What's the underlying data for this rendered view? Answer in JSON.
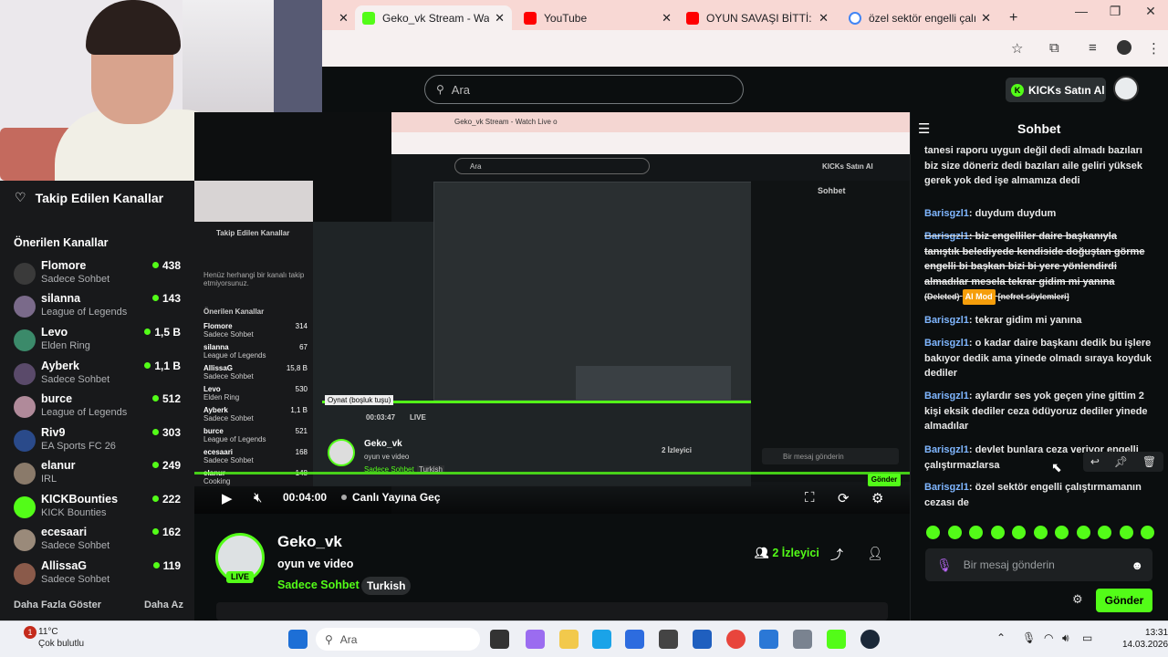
{
  "browser": {
    "tabs": [
      {
        "title": "Geko_vk Stream - Watch Live on KICK",
        "color": "#53fc18"
      },
      {
        "title": "YouTube",
        "color": "#ff0000"
      },
      {
        "title": "OYUN SAVAŞI BİTTİ: PLAYSTATION",
        "color": "#ff0000"
      },
      {
        "title": "özel sektör engelli çalıştırmamanın",
        "color": "#4285f4"
      }
    ],
    "new_tab": "+",
    "close": "✕"
  },
  "topnav": {
    "search_placeholder": "Ara",
    "buy_kicks": "KICKs Satın Al"
  },
  "sidebar": {
    "following_title": "Takip Edilen Kanallar",
    "recommended_title": "Önerilen Kanallar",
    "channels": [
      {
        "name": "Flomore",
        "category": "Sadece Sohbet",
        "viewers": "438",
        "avatar": "#3a3a3a"
      },
      {
        "name": "silanna",
        "category": "League of Legends",
        "viewers": "143",
        "avatar": "#7a6a8a"
      },
      {
        "name": "Levo",
        "category": "Elden Ring",
        "viewers": "1,5 B",
        "avatar": "#3b8a6a"
      },
      {
        "name": "Ayberk",
        "category": "Sadece Sohbet",
        "viewers": "1,1 B",
        "avatar": "#5a4a6a"
      },
      {
        "name": "burce",
        "category": "League of Legends",
        "viewers": "512",
        "avatar": "#b08a9a"
      },
      {
        "name": "Riv9",
        "category": "EA Sports FC 26",
        "viewers": "303",
        "avatar": "#2a4a8a"
      },
      {
        "name": "elanur",
        "category": "IRL",
        "viewers": "249",
        "avatar": "#8a7a6a"
      },
      {
        "name": "KICKBounties",
        "category": "KICK Bounties",
        "viewers": "222",
        "avatar": "#53fc18"
      },
      {
        "name": "ecesaari",
        "category": "Sadece Sohbet",
        "viewers": "162",
        "avatar": "#9a8a7a"
      },
      {
        "name": "AllissaG",
        "category": "Sadece Sohbet",
        "viewers": "119",
        "avatar": "#8a5a4a"
      }
    ],
    "show_more": "Daha Fazla Göster",
    "show_less": "Daha Az"
  },
  "player": {
    "time": "00:04:00",
    "go_live": "Canlı Yayına Geç"
  },
  "stream_embedded": {
    "tab_title": "Geko_vk Stream - Watch Live o",
    "search": "Ara",
    "buy_kicks": "KICKs Satın Al",
    "chat_title": "Sohbet",
    "following": "Takip Edilen Kanallar",
    "no_follow": "Henüz herhangi bir kanalı takip etmiyorsunuz.",
    "recommended": "Önerilen Kanallar",
    "tooltip": "Oynat (boşluk tuşu)",
    "time": "00:03:47",
    "live": "LIVE",
    "name": "Geko_vk",
    "title": "oyun ve video",
    "category": "Sadece Sohbet",
    "tag": "Turkish",
    "viewers": "2 İzleyici",
    "message_placeholder": "Bir mesaj gönderin",
    "send": "Gönder",
    "channels": [
      {
        "name": "Flomore",
        "category": "Sadece Sohbet",
        "viewers": "314"
      },
      {
        "name": "silanna",
        "category": "League of Legends",
        "viewers": "67"
      },
      {
        "name": "AllissaG",
        "category": "Sadece Sohbet",
        "viewers": "15,8 B"
      },
      {
        "name": "Levo",
        "category": "Elden Ring",
        "viewers": "530"
      },
      {
        "name": "Ayberk",
        "category": "Sadece Sohbet",
        "viewers": "1,1 B"
      },
      {
        "name": "burce",
        "category": "League of Legends",
        "viewers": "521"
      },
      {
        "name": "ecesaari",
        "category": "Sadece Sohbet",
        "viewers": "168"
      },
      {
        "name": "elanur",
        "category": "Cooking",
        "viewers": "148"
      }
    ]
  },
  "streamer": {
    "live": "LIVE",
    "name": "Geko_vk",
    "title": "oyun ve video",
    "category": "Sadece Sohbet",
    "tag": "Turkish",
    "viewer_count": "2",
    "viewer_word": "İzleyici"
  },
  "chat": {
    "title": "Sohbet",
    "messages": [
      {
        "user": "",
        "text": "tanesi raporu uygun değil dedi almadı bazıları biz size döneriz dedi bazıları aile geliri yüksek gerek yok ded işe almamıza dedi"
      },
      {
        "user": "Barisgzl1",
        "text": "duydum duydum"
      },
      {
        "user": "Barisgzl1",
        "text": "biz engelliler daire başkanıyla tanıştık belediyede kendiside doğuştan görme engelli bi başkan bizi bi yere yönlendirdi almadılar mesela tekrar gidim mi yanına",
        "deleted": "(Deleted)",
        "mod": "AI Mod",
        "reason": "[nefret söylemleri]"
      },
      {
        "user": "Barisgzl1",
        "text": "tekrar gidim mi yanına"
      },
      {
        "user": "Barisgzl1",
        "text": "o kadar daire başkanı dedik bu işlere bakıyor dedik ama yinede olmadı sıraya koyduk dediler"
      },
      {
        "user": "Barisgzl1",
        "text": "aylardır ses yok geçen yine gittim 2 kişi eksik dediler ceza ödüyoruz dediler yinede almadılar"
      },
      {
        "user": "Barisgzl1",
        "text": "devlet bunlara ceza veriyor engelli çalıştırmazlarsa"
      },
      {
        "user": "Barisgzl1",
        "text": "özel sektör engelli çalıştırmamanın cezası de"
      }
    ],
    "input_placeholder": "Bir mesaj gönderin",
    "send": "Gönder"
  },
  "taskbar": {
    "notification_count": "1",
    "temperature": "11°C",
    "weather": "Çok bulutlu",
    "search": "Ara",
    "time": "13:31",
    "date": "14.03.2026"
  }
}
